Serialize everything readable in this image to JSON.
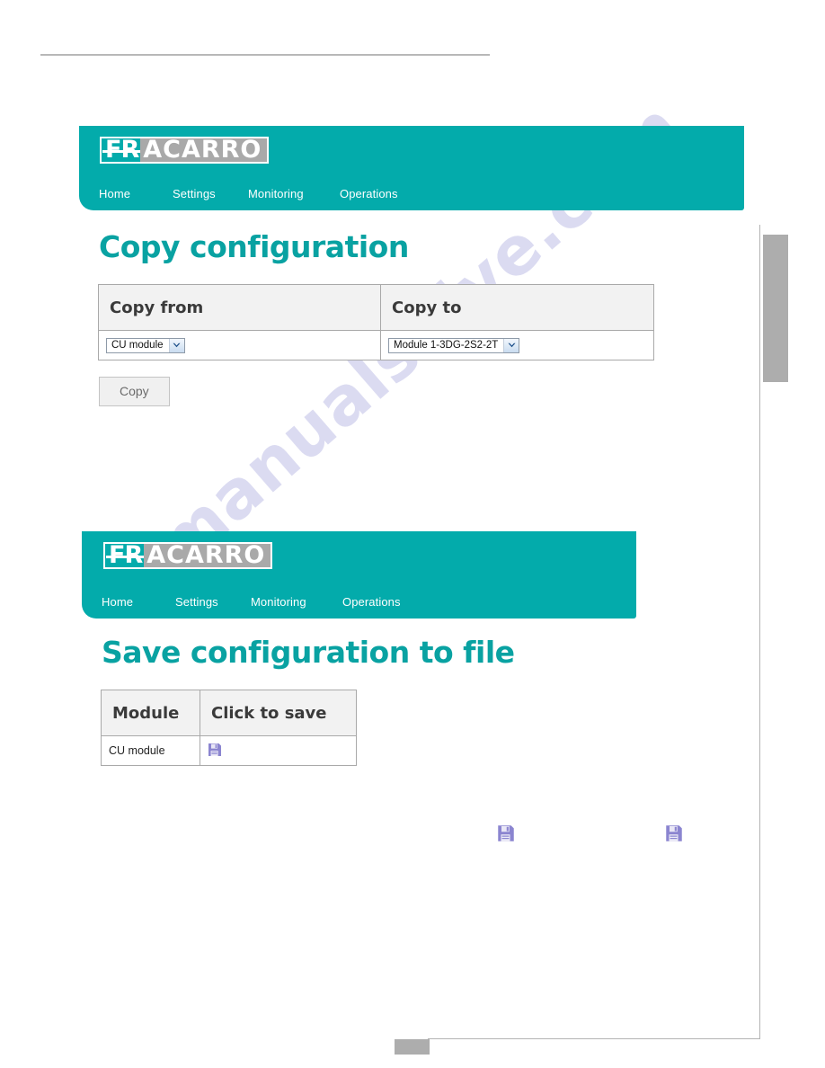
{
  "page": {
    "watermark": "manualshive.com",
    "brand_teal": "#03ABAB",
    "heading_color": "#09A2A2",
    "floppy_color": "#8B85D0"
  },
  "sections": [
    {
      "logo": {
        "prefix": "FR",
        "suffix": "ACARRO",
        "icon": "fracarro-logo"
      },
      "nav": [
        {
          "label": "Home"
        },
        {
          "label": "Settings"
        },
        {
          "label": "Monitoring"
        },
        {
          "label": "Operations"
        }
      ],
      "title": "Copy configuration",
      "table": {
        "headers": [
          "Copy from",
          "Copy to"
        ],
        "copy_from_select": {
          "value": "CU module"
        },
        "copy_to_select": {
          "value": "Module 1-3DG-2S2-2T"
        }
      },
      "button": {
        "label": "Copy"
      }
    },
    {
      "logo": {
        "prefix": "FR",
        "suffix": "ACARRO",
        "icon": "fracarro-logo"
      },
      "nav": [
        {
          "label": "Home"
        },
        {
          "label": "Settings"
        },
        {
          "label": "Monitoring"
        },
        {
          "label": "Operations"
        }
      ],
      "title": "Save configuration to file",
      "table": {
        "headers": [
          "Module",
          "Click to save"
        ],
        "rows": [
          {
            "module": "CU module",
            "action_icon": "floppy-disk-icon"
          }
        ]
      }
    }
  ],
  "loose_icons": [
    {
      "name": "floppy-disk-icon"
    },
    {
      "name": "floppy-disk-icon"
    }
  ]
}
